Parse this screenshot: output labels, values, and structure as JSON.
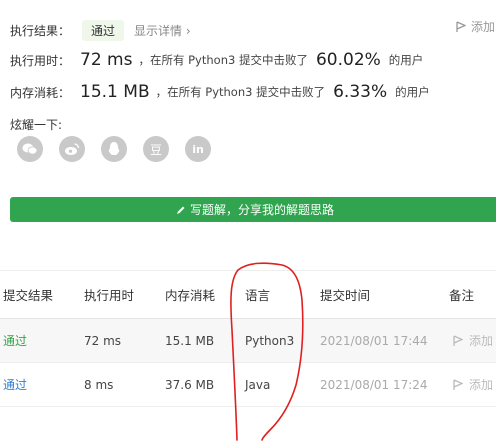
{
  "summary": {
    "result_label": "执行结果：",
    "result_badge": "通过",
    "detail_link": "显示详情 ›",
    "add_note": "添加"
  },
  "runtime": {
    "label": "执行用时：",
    "value": "72 ms",
    "text": "，在所有 Python3 提交中击败了",
    "percent": "60.02%",
    "suffix": "的用户"
  },
  "memory": {
    "label": "内存消耗：",
    "value": "15.1 MB",
    "text": "，在所有 Python3 提交中击败了",
    "percent": "6.33%",
    "suffix": "的用户"
  },
  "share": {
    "title": "炫耀一下:",
    "icons": [
      "wechat-icon",
      "weibo-icon",
      "qq-icon",
      "douban-icon",
      "linkedin-icon"
    ],
    "douban_glyph": "豆",
    "linkedin_glyph": "in"
  },
  "write_button": {
    "label": "写题解，分享我的解题思路",
    "color": "#31a44f"
  },
  "table": {
    "headers": [
      "提交结果",
      "执行用时",
      "内存消耗",
      "语言",
      "提交时间",
      "备注"
    ],
    "rows": [
      {
        "result": "通过",
        "runtime": "72 ms",
        "memory": "15.1 MB",
        "language": "Python3",
        "time": "2021/08/01 17:44",
        "note": "添加"
      },
      {
        "result": "通过",
        "runtime": "8 ms",
        "memory": "37.6 MB",
        "language": "Java",
        "time": "2021/08/01 17:24",
        "note": "添加"
      }
    ]
  },
  "annotation": {
    "color": "#e02020"
  }
}
